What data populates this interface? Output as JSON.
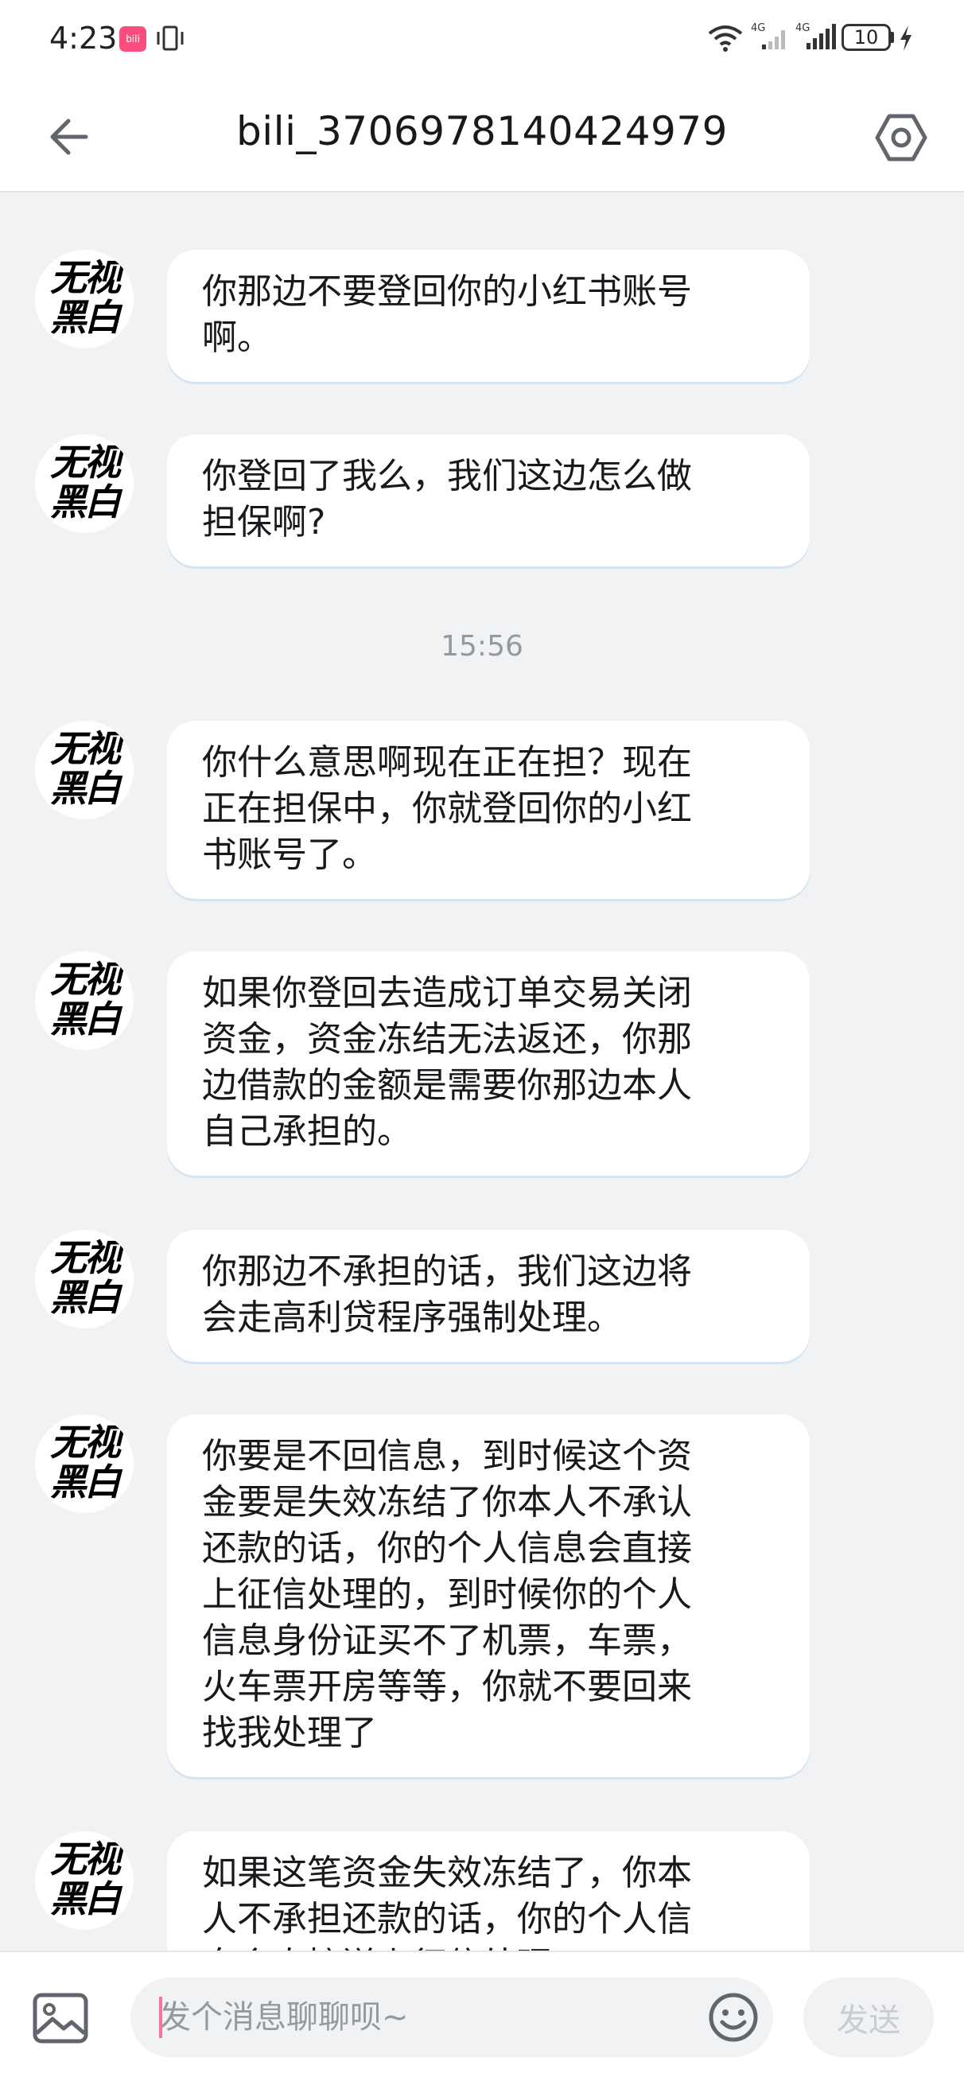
{
  "status_bar": {
    "time": "4:23",
    "app_badge": "bili",
    "battery": "10",
    "network_1": "4G",
    "network_2": "4G"
  },
  "header": {
    "title": "bili_3706978140424979"
  },
  "avatar_text": "无视\n黑白",
  "messages": [
    {
      "text": "你那边不要登回你的小红书账号\n啊。"
    },
    {
      "text": "你登回了我么，我们这边怎么做\n担保啊?"
    },
    {
      "timestamp": "15:56"
    },
    {
      "text": " 你什么意思啊现在正在担？现在\n正在担保中，你就登回你的小红\n书账号了。"
    },
    {
      "text": "如果你登回去造成订单交易关闭\n资金，资金冻结无法返还，你那\n边借款的金额是需要你那边本人\n自己承担的。"
    },
    {
      "text": "你那边不承担的话，我们这边将\n会走高利贷程序强制处理。"
    },
    {
      "text": "你要是不回信息，到时候这个资\n金要是失效冻结了你本人不承认\n还款的话，你的个人信息会直接\n上征信处理的，到时候你的个人\n信息身份证买不了机票，车票，\n火车票开房等等，你就不要回来\n找我处理了"
    },
    {
      "text": "如果这笔资金失效冻结了，你本\n人不承担还款的话，你的个人信\n息会直接送上征信处理。"
    }
  ],
  "input": {
    "placeholder": "发个消息聊聊呗~",
    "value": ""
  },
  "send_label": "发送",
  "colors": {
    "accent": "#fb7299",
    "background": "#f1f2f3",
    "bubble": "#ffffff"
  },
  "icons": [
    "back-arrow-icon",
    "settings-icon",
    "image-icon",
    "emoji-icon",
    "wifi-icon",
    "signal-icon",
    "battery-icon"
  ]
}
